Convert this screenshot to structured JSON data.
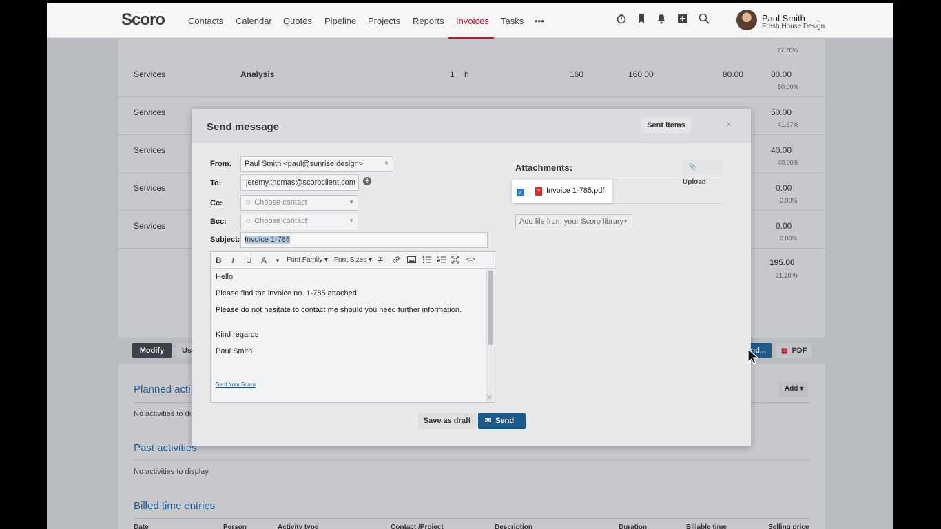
{
  "nav": {
    "logo": "Scoro",
    "items": [
      "Contacts",
      "Calendar",
      "Quotes",
      "Pipeline",
      "Projects",
      "Reports",
      "Invoices",
      "Tasks",
      "•••"
    ],
    "active": "Invoices",
    "icons": [
      "timer-icon",
      "bookmark-icon",
      "bell-icon",
      "add-icon",
      "search-icon"
    ],
    "user": {
      "name": "Paul Smith",
      "company": "Fresh House Design"
    }
  },
  "invoice_rows": {
    "top_percent": "27.78%",
    "rows": [
      {
        "type": "Services",
        "name": "Analysis",
        "qty": "1",
        "unit": "h",
        "price": "160",
        "sum": "160.00",
        "cost": "80.00",
        "margin": "80.00",
        "margin_pct": "50.00%"
      },
      {
        "type": "Services",
        "name": "",
        "qty": "",
        "unit": "",
        "price": "",
        "sum": "",
        "cost": "",
        "margin": "50.00",
        "margin_pct": "41.67%"
      },
      {
        "type": "Services",
        "name": "",
        "qty": "",
        "unit": "",
        "price": "",
        "sum": "",
        "cost": "",
        "margin": "40.00",
        "margin_pct": "40.00%"
      },
      {
        "type": "Services",
        "name": "",
        "qty": "",
        "unit": "",
        "price": "",
        "sum": "",
        "cost": "",
        "margin": "0.00",
        "margin_pct": "0.00%"
      },
      {
        "type": "Services",
        "name": "",
        "qty": "",
        "unit": "",
        "price": "",
        "sum": "",
        "cost": "",
        "margin": "0.00",
        "margin_pct": "0.00%"
      }
    ],
    "total": "195.00",
    "total_pct": "31.20 %"
  },
  "actions": {
    "modify": "Modify",
    "us": "Us",
    "send_partial": "nd...",
    "pdf": "PDF"
  },
  "activities": {
    "planned_title": "Planned acti",
    "planned_note": "No activities to di",
    "add_label": "Add",
    "past_title": "Past activities",
    "past_note": "No activities to display.",
    "billed_title": "Billed time entries",
    "columns": [
      "Date",
      "Person",
      "Activity type",
      "Contact /Project",
      "Description",
      "Duration",
      "Billable time",
      "Selling price"
    ]
  },
  "modal": {
    "title": "Send message",
    "sent_items": "Sent items",
    "close": "×",
    "from_label": "From:",
    "from_value": "Paul Smith <paul@sunrise.design>",
    "to_label": "To:",
    "to_value": "jeremy.thomas@scoroclient.com",
    "cc_label": "Cc:",
    "cc_placeholder": "Choose contact",
    "bcc_label": "Bcc:",
    "bcc_placeholder": "Choose contact",
    "subject_label": "Subject:",
    "subject_value": "Invoice 1-785",
    "toolbar": {
      "font_family": "Font Family",
      "font_sizes": "Font Sizes"
    },
    "body": [
      "Hello",
      "Please find the invoice no. 1-785 attached.",
      "Please do not hesitate to contact me should you need further information.",
      "Kind regards",
      "Paul Smith"
    ],
    "signature_link": "Sent from Scoro",
    "save_draft": "Save as draft",
    "send": "Send",
    "attachments_title": "Attachments:",
    "upload": "Upload",
    "attachment_name": "Invoice 1-785.pdf",
    "library_placeholder": "Add file from your Scoro library"
  }
}
